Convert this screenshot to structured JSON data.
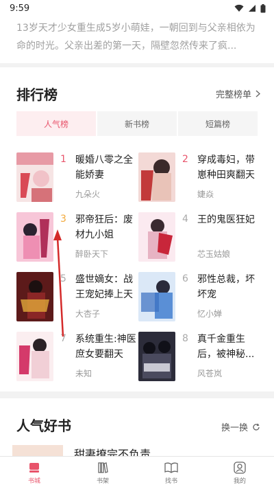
{
  "status": {
    "time": "9:59"
  },
  "intro": {
    "text": "13岁天才少女重生成5岁小萌娃，一朝回到与父亲相依为命的时光。父亲出差的第一天，隔壁忽然传来了疯..."
  },
  "ranking": {
    "title": "排行榜",
    "more_label": "完整榜单",
    "tabs": [
      "人气榜",
      "新书榜",
      "短篇榜"
    ],
    "books": [
      {
        "rank": "1",
        "title": "暖婚八零之全能娇妻",
        "author": "九朵火",
        "cover_color": "#d94a55"
      },
      {
        "rank": "2",
        "title": "穿成毒妇，带崽种田爽翻天",
        "author": "婕焱",
        "cover_color": "#c23a3a"
      },
      {
        "rank": "3",
        "title": "邪帝狂后：废材九小姐",
        "author": "醉卧天下",
        "cover_color": "#ee8fb3"
      },
      {
        "rank": "4",
        "title": "王的鬼医狂妃",
        "author": "芯玉姑娘",
        "cover_color": "#e7b3c3"
      },
      {
        "rank": "5",
        "title": "盛世嫡女：战王宠妃捧上天",
        "author": "大杏子",
        "cover_color": "#8a2626"
      },
      {
        "rank": "6",
        "title": "邪性总裁，坏坏宠",
        "author": "忆小婵",
        "cover_color": "#5a8fd6"
      },
      {
        "rank": "7",
        "title": "系统重生:神医庶女要翻天",
        "author": "未知",
        "cover_color": "#f1cfd6"
      },
      {
        "rank": "8",
        "title": "真千金重生后，被神秘...",
        "author": "风苍岚",
        "cover_color": "#2c2c3a"
      }
    ]
  },
  "popular": {
    "title": "人气好书",
    "refresh_label": "换一换",
    "first_book_title": "甜妻撩完不负责"
  },
  "nav": {
    "items": [
      {
        "label": "书城",
        "icon": "bookstore-icon"
      },
      {
        "label": "书架",
        "icon": "bookshelf-icon"
      },
      {
        "label": "找书",
        "icon": "find-book-icon"
      },
      {
        "label": "我的",
        "icon": "profile-icon"
      }
    ]
  },
  "colors": {
    "accent": "#e8546b",
    "rank3": "#f2a93b"
  }
}
